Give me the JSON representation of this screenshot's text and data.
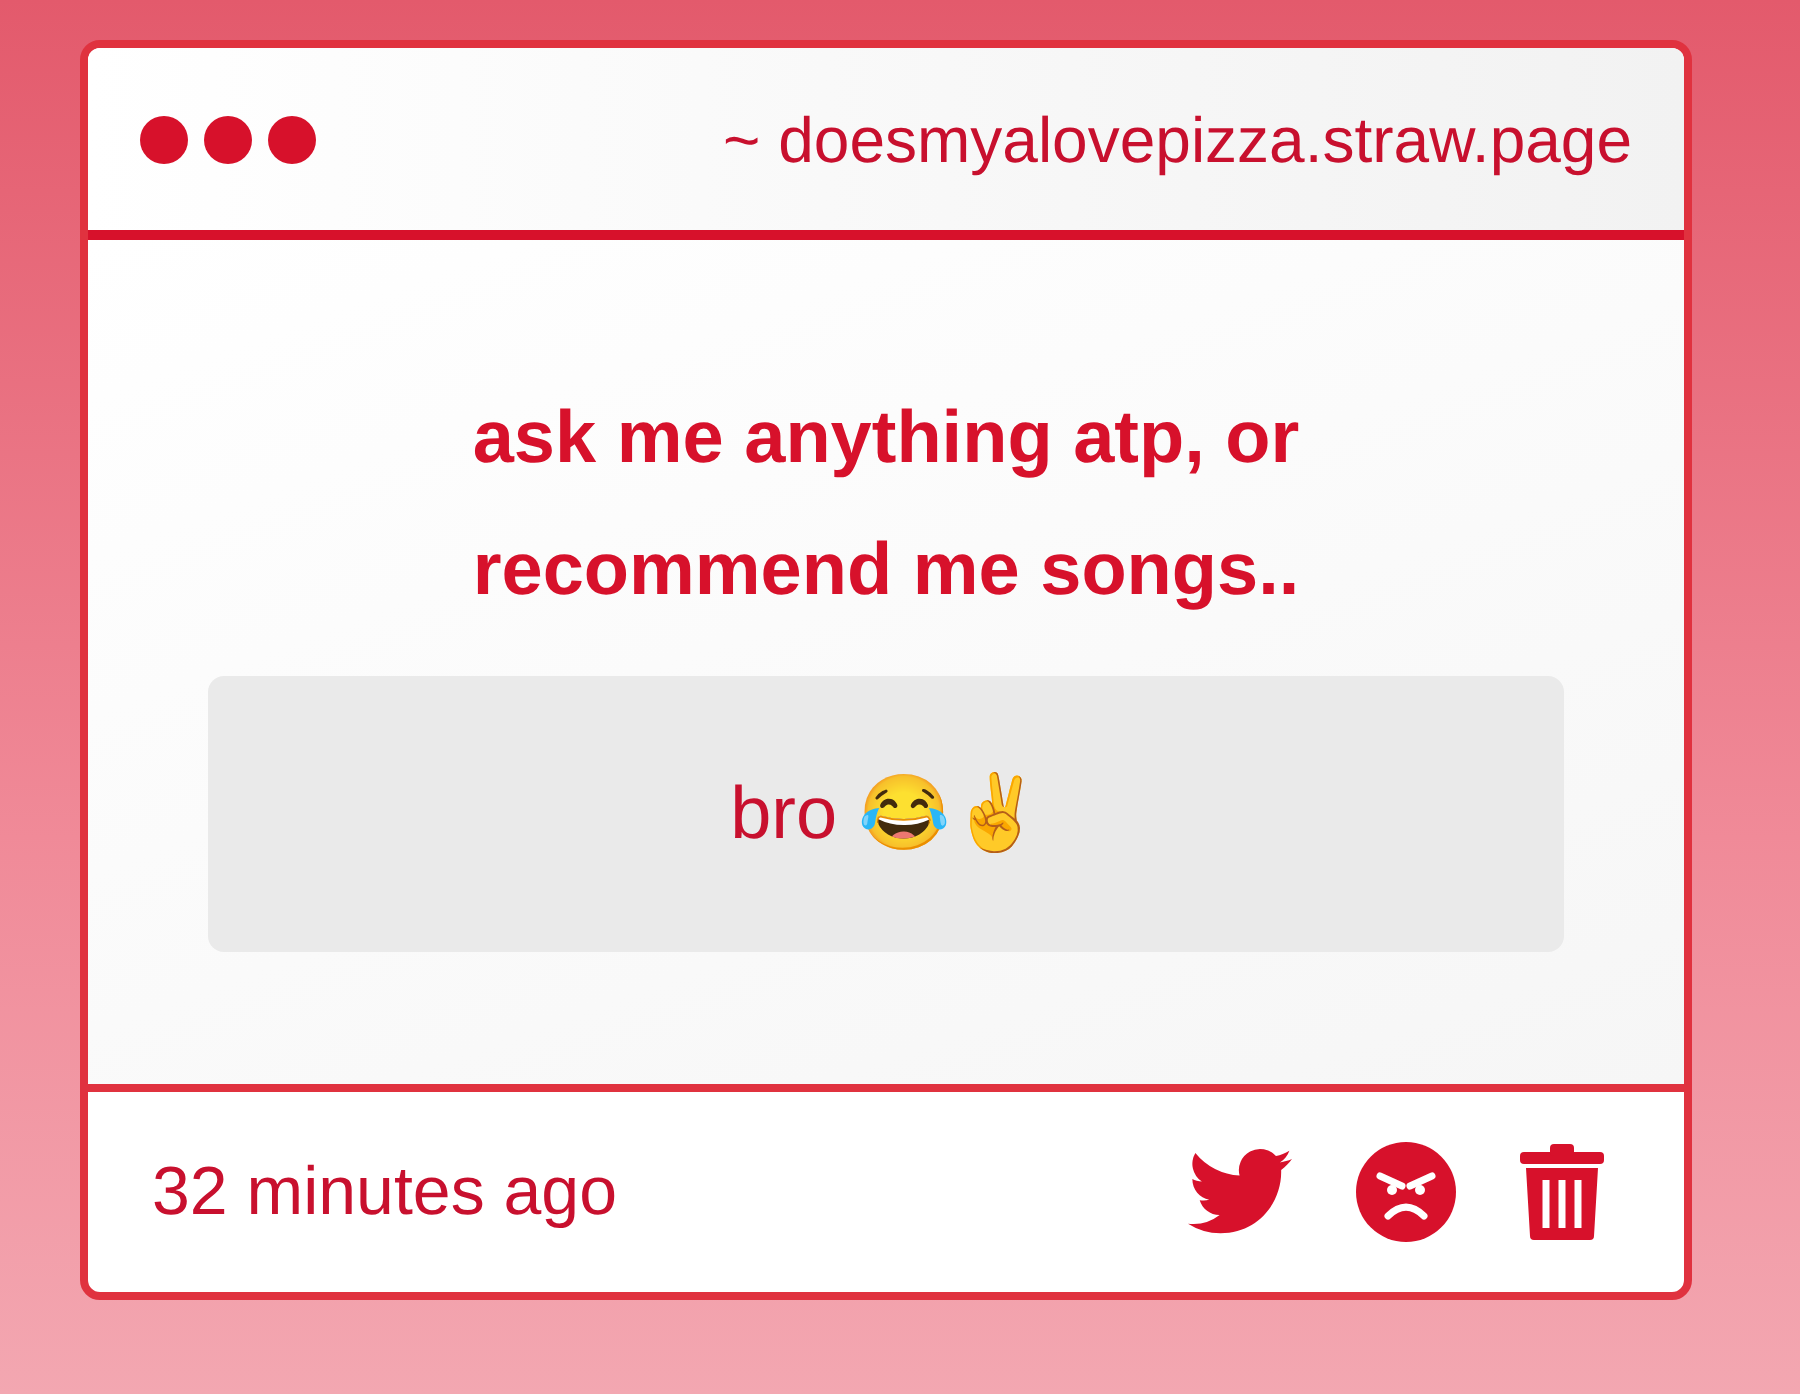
{
  "window": {
    "title": "~ doesmyalovepizza.straw.page"
  },
  "question": "ask me anything atp, or recommend me songs..",
  "answer": "bro 😂✌️",
  "footer": {
    "time": "32 minutes ago"
  }
}
